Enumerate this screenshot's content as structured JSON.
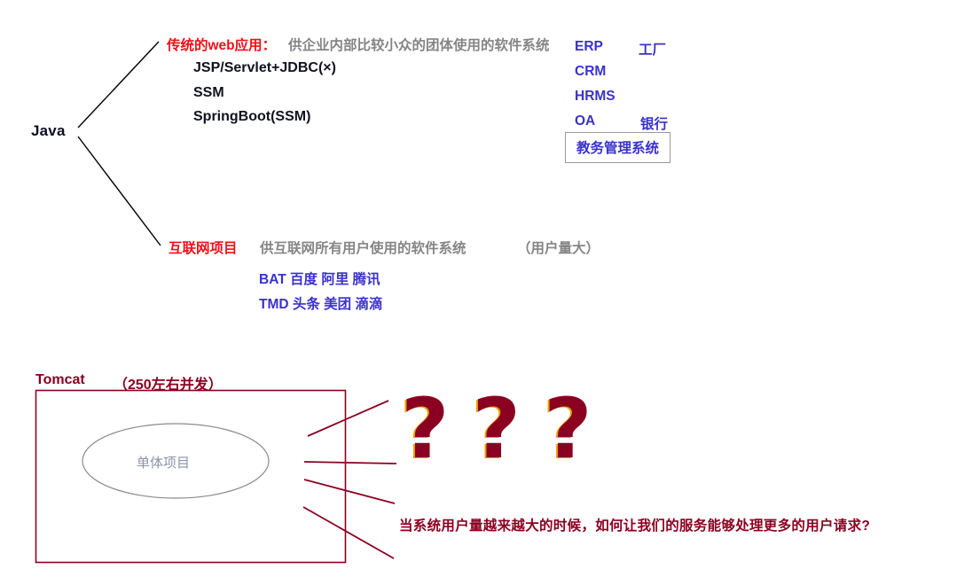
{
  "diagram": {
    "root_label": "Java",
    "branch_traditional": {
      "title": "传统的web应用：",
      "description": "供企业内部比较小众的团体使用的软件系统",
      "stack": [
        "JSP/Servlet+JDBC(×)",
        "SSM",
        "SpringBoot(SSM)"
      ],
      "systems": [
        {
          "abbr": "ERP",
          "example": "工厂"
        },
        {
          "abbr": "CRM",
          "example": ""
        },
        {
          "abbr": "HRMS",
          "example": ""
        },
        {
          "abbr": "OA",
          "example": "银行"
        }
      ],
      "boxed_system": "教务管理系统"
    },
    "branch_internet": {
      "title": "互联网项目",
      "description": "供互联网所有用户使用的软件系统",
      "note": "（用户量大）",
      "companies": [
        "BAT 百度  阿里  腾讯",
        "TMD 头条  美团  滴滴"
      ]
    },
    "server_section": {
      "server_label": "Tomcat",
      "capacity_note": "（250左右并发）",
      "node_label": "单体项目",
      "question_marks": [
        "?",
        "?",
        "?"
      ],
      "question_text": "当系统用户量越来越大的时候，如何让我们的服务能够处理更多的用户请求?"
    }
  },
  "colors": {
    "accent_red": "#f01018",
    "accent_blue": "#3a32cc",
    "accent_darkred": "#8b0020",
    "muted_gray": "#858585",
    "ellipse_gray": "#8c93a8"
  }
}
